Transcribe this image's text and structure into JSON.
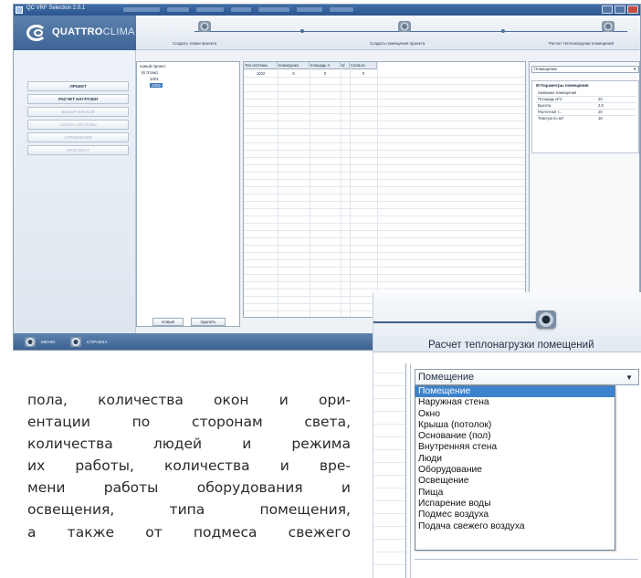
{
  "window": {
    "title": "QC VRF Selection 2.0.1",
    "brand_main": "QUATTRO",
    "brand_thin": "CLIMA"
  },
  "steps": [
    {
      "label": "Создать этажи проекта"
    },
    {
      "label": "Создать помещения проекта"
    },
    {
      "label": "Расчет теплонагрузки помещений"
    }
  ],
  "sidebar": {
    "items": [
      {
        "label": "ПРОЕКТ",
        "enabled": true
      },
      {
        "label": "РАСЧЕТ НАГРУЗКИ",
        "enabled": true
      },
      {
        "label": "ВЫБОР БЛОКОВ",
        "enabled": false
      },
      {
        "label": "СХЕМА СИСТЕМЫ",
        "enabled": false
      },
      {
        "label": "УПРАВЛЕНИЕ",
        "enabled": false
      },
      {
        "label": "РЕЗУЛЬТАТ",
        "enabled": false
      }
    ]
  },
  "tree": {
    "root": "новый проект",
    "floor": "Этаж1",
    "room1": "1001",
    "room2": "1002",
    "new_button": "Новый",
    "delete_button": "Удалить"
  },
  "grid": {
    "columns": [
      "Тип системы",
      "помагрузка",
      "площадь п",
      "Id",
      "CoolLoa"
    ],
    "row": [
      "1002",
      "0",
      "0",
      "",
      "0"
    ]
  },
  "props": {
    "combo_value": "Помещение",
    "header": "Параметры помещения",
    "rows": [
      {
        "name": "Название помещения",
        "value": ""
      },
      {
        "name": "Площадь м^2",
        "value": "20"
      },
      {
        "name": "Высота",
        "value": "2,8"
      },
      {
        "name": "Расчетная т...",
        "value": "20"
      },
      {
        "name": "Темп-ра по м/т",
        "value": "18"
      }
    ]
  },
  "statusbar": {
    "menu": "МЕНЮ",
    "help": "СПРАВКА"
  },
  "zoom": {
    "step_label": "Расчет теплонагрузки помещений",
    "combo_value": "Помещение",
    "options": [
      "Помещение",
      "Наружная стена",
      "Окно",
      "Крыша (потолок)",
      "Основание (пол)",
      "Внутренняя стена",
      "Люди",
      "Оборудование",
      "Освещение",
      "Пища",
      "Испарение воды",
      "Подмес воздуха",
      "Подача свежего воздуха"
    ],
    "selected_index": 0
  },
  "article": {
    "lines": [
      "пола, количества окон и ори-",
      "ентации по сторонам света,",
      "количества людей и режима",
      "их работы, количества и вре-",
      "мени работы оборудования и",
      "освещения, типа помещения,",
      "а также от подмеса свежего"
    ]
  }
}
